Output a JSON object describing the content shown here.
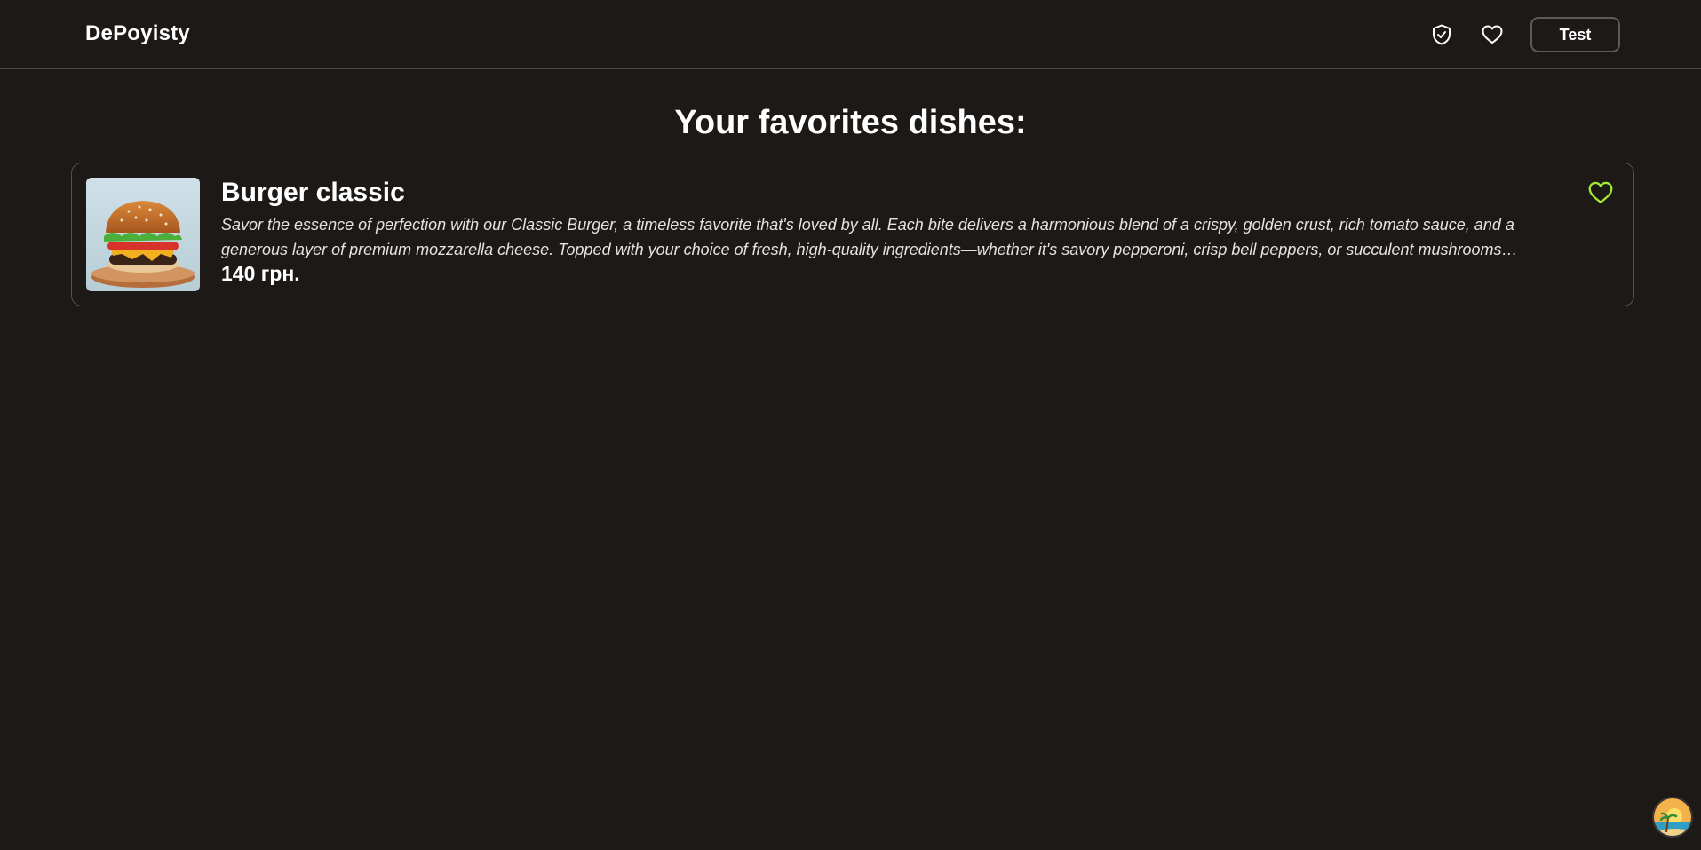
{
  "header": {
    "brand": "DePoyisty",
    "user_button_label": "Test",
    "icons": [
      "shield-check-icon",
      "heart-icon"
    ]
  },
  "main": {
    "title": "Your favorites dishes:",
    "favorites": [
      {
        "name": "Burger classic",
        "description": "Savor the essence of perfection with our Classic Burger, a timeless favorite that's loved by all. Each bite delivers a harmonious blend of a crispy, golden crust, rich tomato sauce, and a generous layer of premium mozzarella cheese. Topped with your choice of fresh, high-quality ingredients—whether it's savory pepperoni, crisp bell peppers, or succulent mushrooms—our Classic Burger...",
        "price": "140 грн.",
        "image": "burger-image",
        "favorited": true
      }
    ]
  },
  "colors": {
    "background": "#1c1917",
    "favorite_accent": "#a3e635",
    "border": "#55504d"
  }
}
